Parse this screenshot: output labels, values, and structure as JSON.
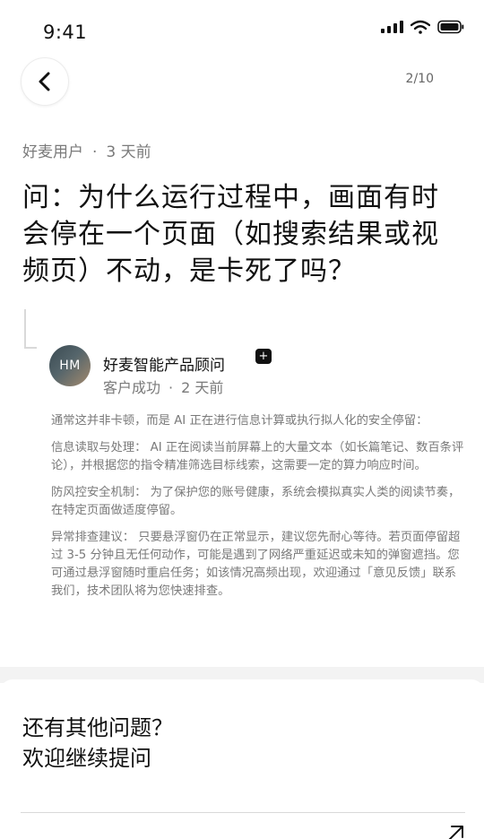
{
  "status_bar": {
    "time": "9:41"
  },
  "nav": {
    "page_counter": "2/10"
  },
  "question": {
    "author": "好麦用户",
    "separator": "·",
    "time_ago": "3 天前",
    "title": "问：为什么运行过程中，画面有时会停在一个页面（如搜索结果或视频页）不动，是卡死了吗？"
  },
  "answer": {
    "avatar_initials": "HM",
    "answerer_name": "好麦智能产品顾问",
    "badge": "+",
    "role": "客户成功",
    "separator": "·",
    "time_ago": "2 天前",
    "paragraphs": [
      "通常这并非卡顿，而是 AI 正在进行信息计算或执行拟人化的安全停留：",
      "信息读取与处理： AI 正在阅读当前屏幕上的大量文本（如长篇笔记、数百条评论），并根据您的指令精准筛选目标线索，这需要一定的算力响应时间。",
      "防风控安全机制： 为了保护您的账号健康，系统会模拟真实人类的阅读节奏，在特定页面做适度停留。",
      "异常排查建议： 只要悬浮窗仍在正常显示，建议您先耐心等待。若页面停留超过 3-5 分钟且无任何动作，可能是遇到了网络严重延迟或未知的弹窗遮挡。您可通过悬浮窗随时重启任务；如该情况高频出现，欢迎通过「意见反馈」联系我们，技术团队将为您快速排查。"
    ]
  },
  "cta": {
    "line1": "还有其他问题？",
    "line2": "欢迎继续提问"
  },
  "icons": {
    "back": "chevron-left-icon",
    "signal": "signal-icon",
    "wifi": "wifi-icon",
    "battery": "battery-icon",
    "cta_arrow": "arrow-up-right-icon"
  }
}
